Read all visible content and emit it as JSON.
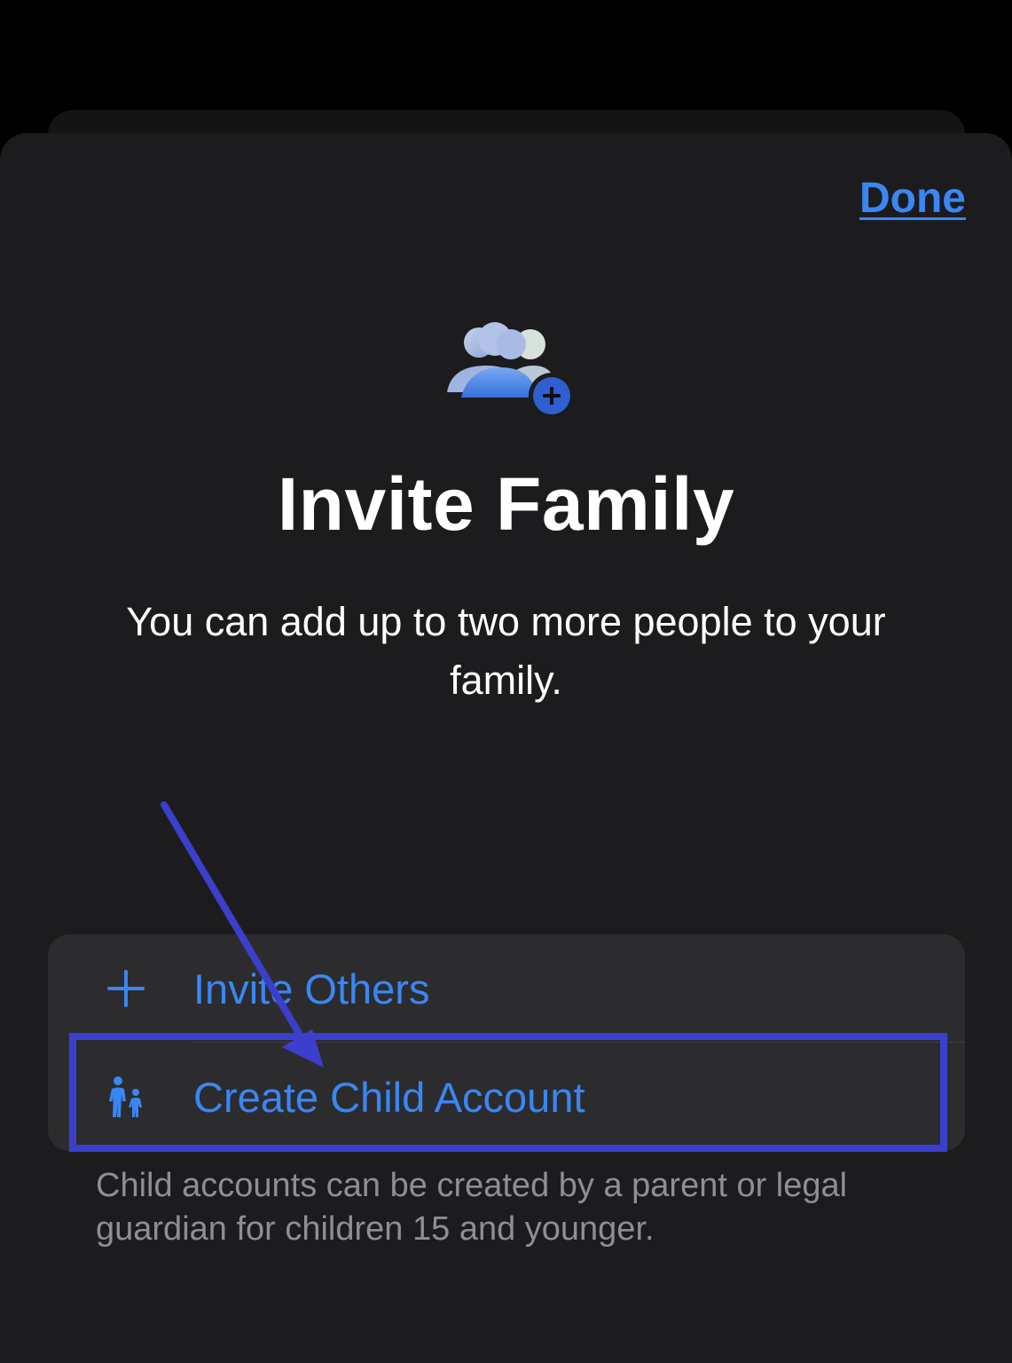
{
  "header": {
    "done_label": "Done"
  },
  "hero": {
    "icon": "family-add-icon",
    "title": "Invite Family",
    "subtitle": "You can add up to two more people to your family."
  },
  "options": [
    {
      "label": "Invite Others",
      "icon": "plus-icon"
    },
    {
      "label": "Create Child Account",
      "icon": "parent-child-icon"
    }
  ],
  "footnote": "Child accounts can be created by a parent or legal guardian for children 15 and younger.",
  "colors": {
    "accent": "#3a86f4",
    "sheet_background": "#1c1c1e",
    "group_background": "#2c2c2e",
    "annotation": "#3c3fcc",
    "secondary_text": "#8e8e93"
  }
}
